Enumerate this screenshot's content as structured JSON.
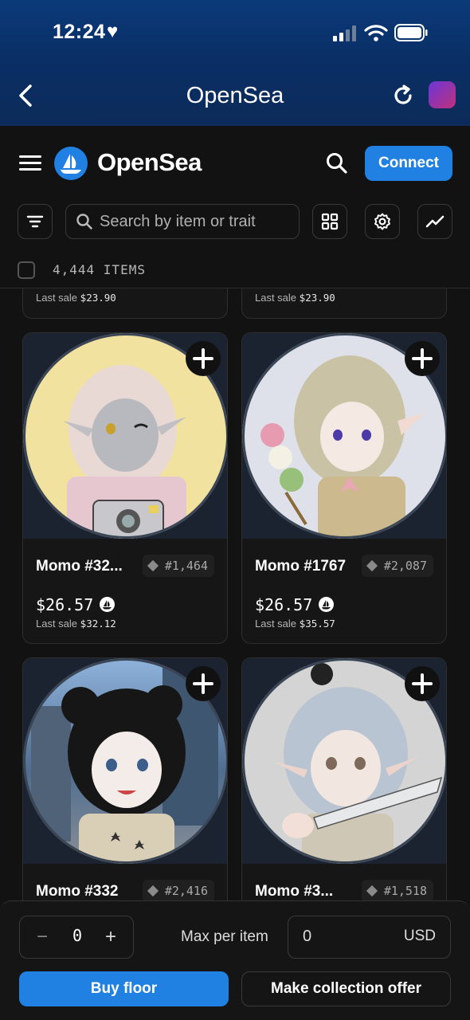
{
  "status_bar": {
    "time": "12:24",
    "heart": "♥"
  },
  "browser": {
    "title": "OpenSea"
  },
  "site": {
    "brand": "OpenSea",
    "connect_label": "Connect"
  },
  "toolbar": {
    "search_placeholder": "Search by item or trait"
  },
  "items": {
    "count_label": "4,444 ITEMS"
  },
  "top_partial_cards": [
    {
      "last_sale_label": "Last sale",
      "last_sale_value": "$23.90"
    },
    {
      "last_sale_label": "Last sale",
      "last_sale_value": "$23.90"
    }
  ],
  "cards": [
    {
      "name": "Momo #32...",
      "rank": "#1,464",
      "price": "$26.57",
      "last_sale_label": "Last sale",
      "last_sale_value": "$32.12",
      "bg": "#f5df82"
    },
    {
      "name": "Momo #1767",
      "rank": "#2,087",
      "price": "$26.57",
      "last_sale_label": "Last sale",
      "last_sale_value": "$35.57",
      "bg": "#dfe2ec"
    },
    {
      "name": "Momo #332",
      "rank": "#2,416",
      "bg": "#6d8fb5"
    },
    {
      "name": "Momo #3...",
      "rank": "#1,518",
      "bg": "#d6d6d6"
    }
  ],
  "bottom_bar": {
    "minus": "−",
    "quantity": "0",
    "plus": "+",
    "max_label": "Max per item",
    "max_value": "0",
    "currency": "USD",
    "buy_label": "Buy floor",
    "offer_label": "Make collection offer"
  },
  "colors": {
    "accent": "#2081e2",
    "background": "#121212"
  }
}
